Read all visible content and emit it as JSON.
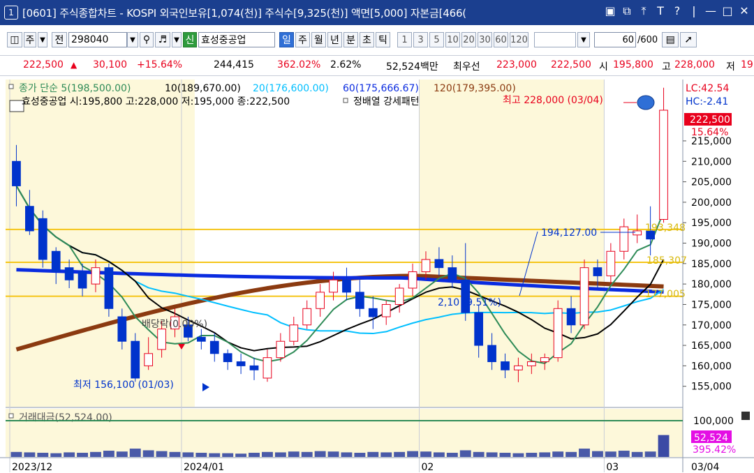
{
  "window": {
    "number": "1",
    "title": "[0601] 주식종합차트 - KOSPI 외국인보유[1,074(천)] 주식수[9,325(천)] 액면[5,000] 자본금[466("
  },
  "toolbar": {
    "main_label": "주",
    "all_label": "전",
    "code": "298040",
    "tag": "신",
    "stock_name": "효성중공업",
    "periods": [
      "일",
      "주",
      "월",
      "년",
      "분",
      "초",
      "틱"
    ],
    "active_period": "일",
    "intervals": [
      "1",
      "3",
      "5",
      "10",
      "20",
      "30",
      "60",
      "120"
    ],
    "count": "60",
    "total": "/600"
  },
  "quote": {
    "price": "222,500",
    "change": "30,100",
    "change_pct": "+15.64%",
    "volume": "244,415",
    "volume_ratio": "362.02%",
    "turnover": "2.62%",
    "amount": "52,524백만",
    "priority_label": "최우선",
    "ask": "223,000",
    "bid": "222,500",
    "open_label": "시",
    "open": "195,800",
    "high_label": "고",
    "high": "228,000",
    "low_label": "저",
    "low": "19"
  },
  "chart_data": {
    "type": "candlestick",
    "legend": {
      "ma5": "종가 단순 5(198,500.00)",
      "ma10": "10(189,670.00)",
      "ma20": "20(176,600.00)",
      "ma60": "60(175,666.67)",
      "ma120": "120(179,395.00)"
    },
    "info_line": "효성중공업 시:195,800 고:228,000 저:195,000 종:222,500",
    "pattern_label": "정배열 강세패턴",
    "lc_label": "LC:42.54",
    "hc_label": "HC:-2.41",
    "ylim": [
      150000,
      230000
    ],
    "yticks": [
      "215,000",
      "210,000",
      "205,000",
      "200,000",
      "195,000",
      "190,000",
      "185,000",
      "180,000",
      "175,000",
      "170,000",
      "165,000",
      "160,000",
      "155,000"
    ],
    "ytick_values": [
      215000,
      210000,
      205000,
      200000,
      195000,
      190000,
      185000,
      180000,
      175000,
      170000,
      165000,
      160000,
      155000
    ],
    "last_price_label": "222,500",
    "last_pct_label": "15.64%",
    "high_annotation": "최고 228,000 (03/04)",
    "low_annotation": "최저 156,100 (01/03)",
    "dividend_annotation": "배당락(0.00%)",
    "level_annotations": [
      {
        "text": "194,127.00",
        "price": 194127
      },
      {
        "text": "193,348",
        "price": 193348
      },
      {
        "text": "185,307",
        "price": 185307
      },
      {
        "text": "177,005",
        "price": 177005
      },
      {
        "text": "2,10 (9.51%)",
        "price": 176500
      }
    ],
    "hlines": [
      193348,
      185307,
      177005
    ],
    "x_labels": [
      "2023/12",
      "2024/01",
      "02",
      "03"
    ],
    "x_label_index": [
      0,
      13,
      31,
      45
    ],
    "right_date": "03/04",
    "candles": [
      [
        210000,
        214000,
        204000,
        199000
      ],
      [
        199000,
        203000,
        193000,
        192000
      ],
      [
        196000,
        198000,
        186000,
        184000
      ],
      [
        188000,
        189000,
        183000,
        180000
      ],
      [
        184000,
        186000,
        181000,
        179000
      ],
      [
        183000,
        185000,
        179000,
        177000
      ],
      [
        180000,
        186000,
        184000,
        178000
      ],
      [
        184000,
        185000,
        174000,
        172000
      ],
      [
        172000,
        174000,
        166000,
        164000
      ],
      [
        166000,
        168000,
        157000,
        156100
      ],
      [
        160000,
        167000,
        163000,
        159000
      ],
      [
        164000,
        171000,
        169000,
        162000
      ],
      [
        169000,
        174000,
        172000,
        167000
      ],
      [
        170000,
        172000,
        167000,
        166000
      ],
      [
        167000,
        169000,
        166000,
        164000
      ],
      [
        166000,
        168000,
        163000,
        161000
      ],
      [
        163000,
        164000,
        161000,
        159000
      ],
      [
        161000,
        163000,
        160000,
        158000
      ],
      [
        160000,
        162000,
        159000,
        156500
      ],
      [
        157000,
        164000,
        162000,
        156100
      ],
      [
        162000,
        168000,
        166000,
        161000
      ],
      [
        166000,
        172000,
        170000,
        165000
      ],
      [
        170000,
        176000,
        174000,
        169000
      ],
      [
        174000,
        180000,
        178000,
        172000
      ],
      [
        178000,
        183000,
        181000,
        176000
      ],
      [
        181000,
        184000,
        178000,
        176000
      ],
      [
        178000,
        181000,
        174000,
        172000
      ],
      [
        174000,
        177000,
        172000,
        169000
      ],
      [
        172000,
        176000,
        175000,
        170000
      ],
      [
        175000,
        180000,
        179000,
        173000
      ],
      [
        179000,
        185000,
        183000,
        177000
      ],
      [
        183000,
        188000,
        186000,
        181000
      ],
      [
        186000,
        189000,
        184000,
        182000
      ],
      [
        184000,
        187000,
        181000,
        179000
      ],
      [
        181000,
        190000,
        173000,
        171000
      ],
      [
        173000,
        175000,
        165000,
        162000
      ],
      [
        165000,
        168000,
        161000,
        159000
      ],
      [
        161000,
        163000,
        159000,
        157000
      ],
      [
        159000,
        162000,
        160000,
        156000
      ],
      [
        160000,
        163000,
        161000,
        158000
      ],
      [
        161000,
        163000,
        162000,
        159000
      ],
      [
        162000,
        176000,
        174000,
        161000
      ],
      [
        174000,
        177000,
        170000,
        168000
      ],
      [
        170000,
        186000,
        184000,
        169000
      ],
      [
        184000,
        186000,
        182000,
        179000
      ],
      [
        182000,
        190000,
        188000,
        180000
      ],
      [
        188000,
        196000,
        194000,
        186000
      ],
      [
        192000,
        197000,
        193000,
        190000
      ],
      [
        193000,
        199000,
        191000,
        187000
      ],
      [
        195800,
        228000,
        222500,
        195000
      ]
    ],
    "volume_label": "거래대금(52,524.00)",
    "volume_ytick": "100,000",
    "volume_last_label": "52,524",
    "volume_last_pct": "395.42%",
    "volumes": [
      12000,
      11000,
      10000,
      9000,
      11000,
      10000,
      12000,
      15000,
      13000,
      20000,
      16000,
      14000,
      12000,
      11000,
      10000,
      9000,
      9000,
      8000,
      10000,
      12000,
      11000,
      13000,
      12000,
      14000,
      13000,
      11000,
      10000,
      12000,
      11000,
      12000,
      14000,
      13000,
      11000,
      10000,
      16000,
      12000,
      11000,
      10000,
      9000,
      10000,
      11000,
      13000,
      12000,
      20000,
      14000,
      13000,
      15000,
      12000,
      13000,
      52524
    ]
  },
  "colors": {
    "up": "#e8001c",
    "down": "#0033cc",
    "ma5": "#2e8b57",
    "ma10": "#000000",
    "ma20": "#00bfff",
    "ma60": "#0a2be0",
    "ma120": "#8b3a10",
    "hline": "#f5c518",
    "shade": "#fdf8da",
    "volume": "#4a5aa8",
    "volume_last": "#e40ee4",
    "volume_ma": "#2e8b57"
  },
  "icons": [
    "window-minimize-icon",
    "window-restore-icon",
    "pin-icon",
    "font-icon",
    "help-icon",
    "close-icon",
    "search-icon",
    "speaker-icon",
    "dropdown-icon",
    "candle-type-icon",
    "drawing-tool-icon"
  ]
}
